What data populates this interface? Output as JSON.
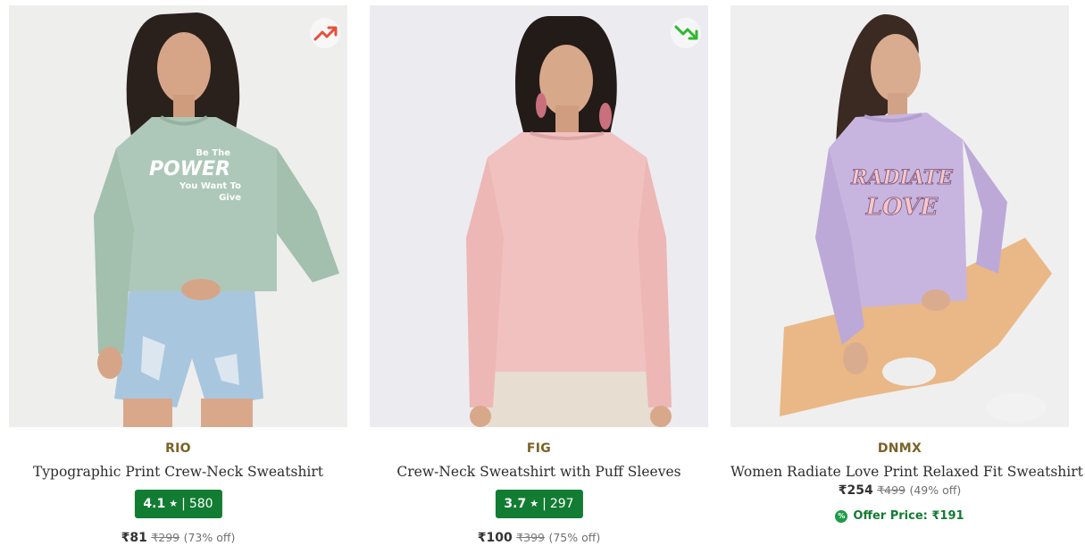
{
  "products": [
    {
      "brand": "RIO",
      "title": "Typographic Print Crew-Neck Sweatshirt",
      "rating": "4.1",
      "rating_count": "580",
      "price": "₹81",
      "mrp": "₹299",
      "discount": "(73% off)",
      "trend": "trending-up",
      "trend_icon": "trending-up-icon",
      "print_text": {
        "line1": "Be The",
        "line2": "POWER",
        "line3": "You Want To",
        "line4": "Give"
      }
    },
    {
      "brand": "FIG",
      "title": "Crew-Neck Sweatshirt with Puff Sleeves",
      "rating": "3.7",
      "rating_count": "297",
      "price": "₹100",
      "mrp": "₹399",
      "discount": "(75% off)",
      "trend": "trending-down",
      "trend_icon": "trending-down-icon"
    },
    {
      "brand": "DNMX",
      "title": "Women Radiate Love Print Relaxed Fit Sweatshirt",
      "price": "₹254",
      "mrp": "₹499",
      "discount": "(49% off)",
      "offer_label": "Offer Price: ₹191",
      "offer_icon": "percent-badge-icon",
      "print_text": {
        "line1": "RADIATE",
        "line2": "LOVE"
      }
    }
  ],
  "colors": {
    "rating_bg": "#127c32",
    "brand_text": "#7a6226",
    "trend_up": "#e8503a",
    "trend_down": "#2eb82e",
    "offer_text": "#127c32"
  }
}
